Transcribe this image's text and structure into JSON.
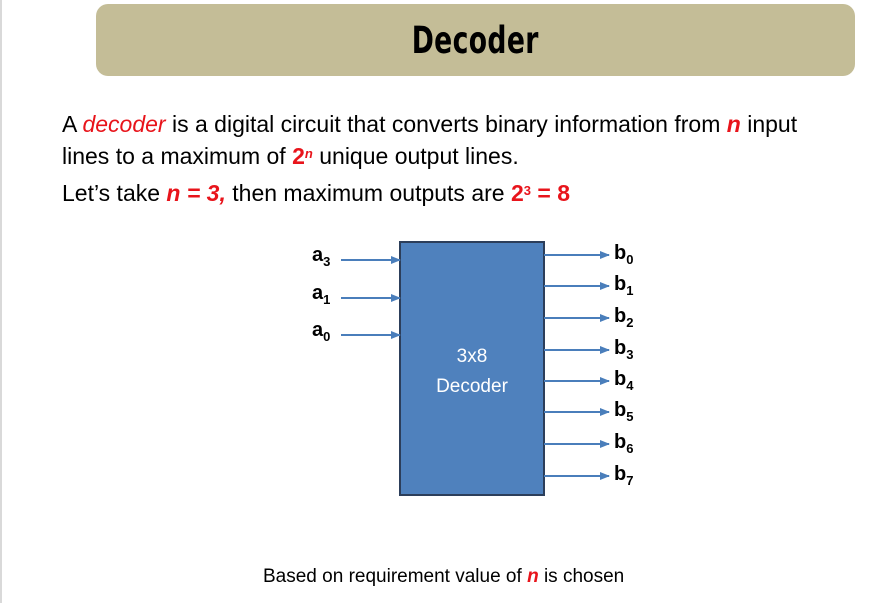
{
  "title": "Decoder",
  "definition": {
    "before": "A ",
    "term": "decoder",
    "middle": " is a digital circuit that converts binary information from ",
    "var_n": "n",
    "after_n": " input",
    "line2_start": "lines to a maximum of ",
    "base": "2",
    "exp": "n",
    "line2_end": " unique output lines."
  },
  "example": {
    "start": "Let’s take ",
    "n_eq": "n = 3,",
    "middle": " then maximum outputs are ",
    "base": "2",
    "exp": "3",
    "result": " = 8"
  },
  "decoder_block": {
    "line1": "3x8",
    "line2": "Decoder",
    "fill": "#4f81bd",
    "stroke": "#2c3e5a"
  },
  "arrow_color": "#4a7ebb",
  "inputs": [
    {
      "base": "a",
      "sub": "3"
    },
    {
      "base": "a",
      "sub": "1"
    },
    {
      "base": "a",
      "sub": "0"
    }
  ],
  "outputs": [
    {
      "base": "b",
      "sub": "0"
    },
    {
      "base": "b",
      "sub": "1"
    },
    {
      "base": "b",
      "sub": "2"
    },
    {
      "base": "b",
      "sub": "3"
    },
    {
      "base": "b",
      "sub": "4"
    },
    {
      "base": "b",
      "sub": "5"
    },
    {
      "base": "b",
      "sub": "6"
    },
    {
      "base": "b",
      "sub": "7"
    }
  ],
  "caption": {
    "start": "Based on requirement value of ",
    "var_n": "n",
    "end": " is chosen"
  }
}
